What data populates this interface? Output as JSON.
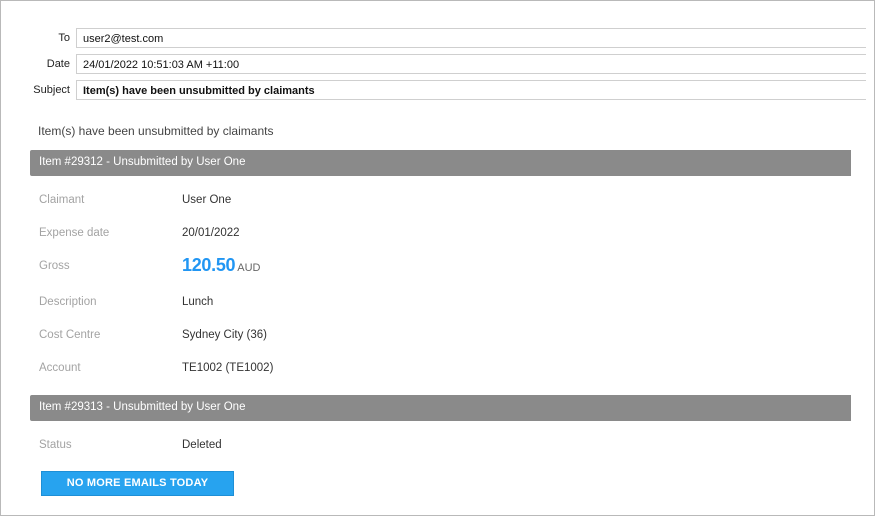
{
  "email": {
    "to_label": "To",
    "to_value": "user2@test.com",
    "date_label": "Date",
    "date_value": "24/01/2022 10:51:03 AM +11:00",
    "subject_label": "Subject",
    "subject_value": "Item(s) have been unsubmitted by claimants"
  },
  "body": {
    "intro": "Item(s) have been unsubmitted by claimants",
    "items": [
      {
        "header": "Item #29312 - Unsubmitted by User One",
        "fields": {
          "claimant_label": "Claimant",
          "claimant_value": "User One",
          "expense_date_label": "Expense date",
          "expense_date_value": "20/01/2022",
          "gross_label": "Gross",
          "gross_amount": "120.50",
          "gross_currency": "AUD",
          "description_label": "Description",
          "description_value": "Lunch",
          "cost_centre_label": "Cost Centre",
          "cost_centre_value": "Sydney City (36)",
          "account_label": "Account",
          "account_value": "TE1002 (TE1002)"
        }
      },
      {
        "header": "Item #29313 - Unsubmitted by User One",
        "fields": {
          "status_label": "Status",
          "status_value": "Deleted"
        }
      }
    ],
    "button_label": "NO MORE EMAILS TODAY"
  },
  "colors": {
    "accent": "#2196f3",
    "button": "#27a3ef",
    "section_bar": "#8a8a8a"
  }
}
